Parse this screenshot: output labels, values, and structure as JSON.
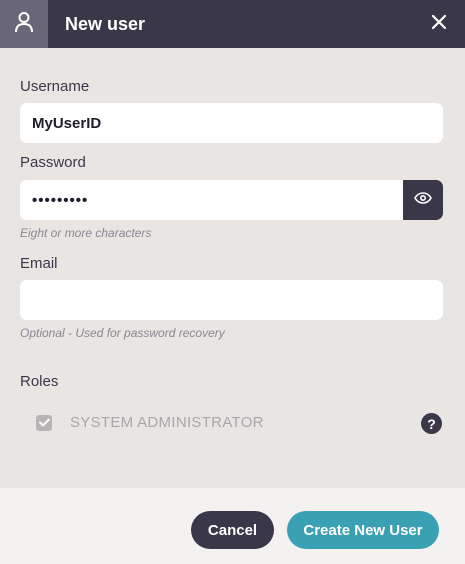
{
  "header": {
    "title": "New user",
    "user_icon": "user-icon",
    "close_icon": "close-icon"
  },
  "form": {
    "username": {
      "label": "Username",
      "value": "MyUserID"
    },
    "password": {
      "label": "Password",
      "masked_value": "•••••••••",
      "hint": "Eight or more characters",
      "toggle_icon": "eye-icon"
    },
    "email": {
      "label": "Email",
      "value": "",
      "hint": "Optional - Used for password recovery"
    },
    "roles": {
      "label": "Roles",
      "items": [
        {
          "label": "SYSTEM ADMINISTRATOR",
          "checked": true,
          "disabled": true
        }
      ],
      "help_icon": "help-icon"
    }
  },
  "footer": {
    "cancel_label": "Cancel",
    "create_label": "Create New User"
  },
  "colors": {
    "header_bg": "#3a3848",
    "body_bg": "#e9e5e2",
    "accent": "#3aa0b3",
    "footer_bg": "#f4f2f1"
  }
}
